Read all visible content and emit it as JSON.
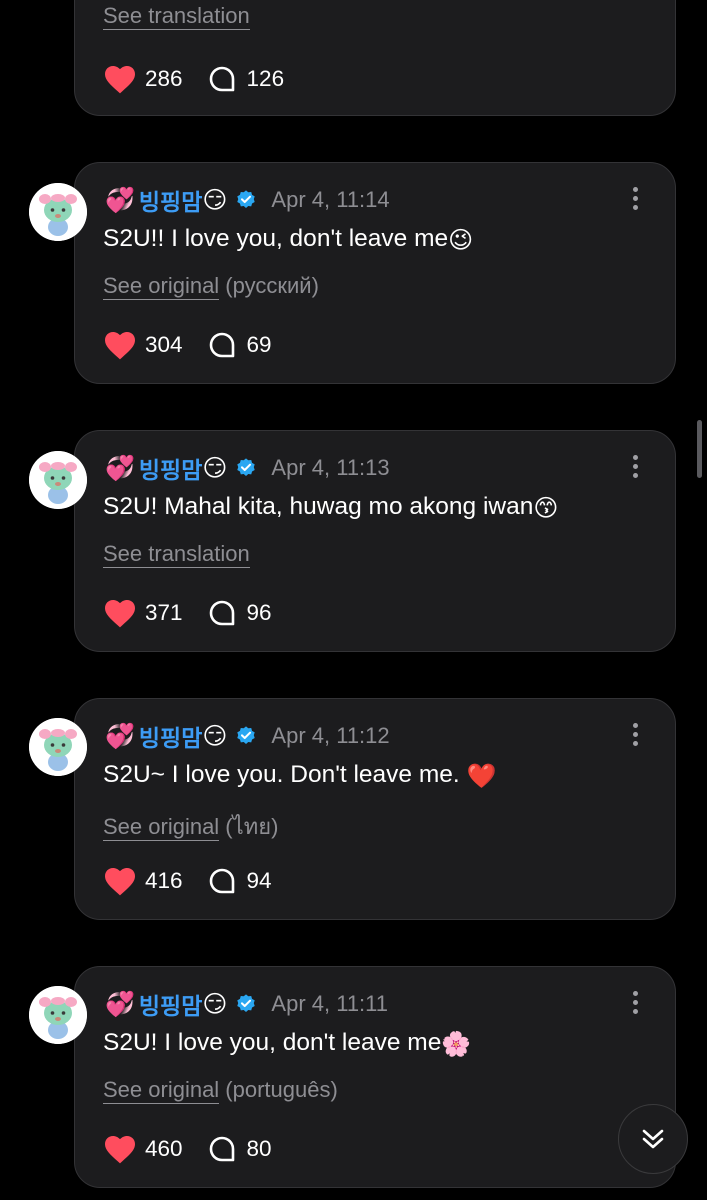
{
  "posts": [
    {
      "see_link": "See translation",
      "see_lang": "",
      "likes": "286",
      "comments": "126"
    },
    {
      "badge_emoji": "💞",
      "username": "빙핑맘",
      "name_emoji": "😏",
      "date": "Apr 4, 11:14",
      "text": "S2U!! I love you, don't leave me",
      "text_emoji": "😉",
      "see_link": "See original",
      "see_lang": " (русский)",
      "likes": "304",
      "comments": "69"
    },
    {
      "badge_emoji": "💞",
      "username": "빙핑맘",
      "name_emoji": "😏",
      "date": "Apr 4, 11:13",
      "text": "S2U! Mahal kita, huwag mo akong iwan",
      "text_emoji": "😙",
      "see_link": "See translation",
      "see_lang": "",
      "likes": "371",
      "comments": "96"
    },
    {
      "badge_emoji": "💞",
      "username": "빙핑맘",
      "name_emoji": "😏",
      "date": "Apr 4, 11:12",
      "text": "S2U~ I love you. Don't leave me. ",
      "text_emoji": "❤️",
      "see_link": "See original",
      "see_lang": " (ไทย)",
      "likes": "416",
      "comments": "94"
    },
    {
      "badge_emoji": "💞",
      "username": "빙핑맘",
      "name_emoji": "😏",
      "date": "Apr 4, 11:11",
      "text": "S2U! I love you, don't leave me",
      "text_emoji": "🌸",
      "see_link": "See original",
      "see_lang": " (português)",
      "likes": "460",
      "comments": "80"
    }
  ],
  "icons": {
    "like": "heart-icon",
    "comment": "comment-bubble-icon",
    "more": "more-vertical-icon",
    "verified": "verified-badge-icon",
    "scroll": "double-chevron-down-icon"
  },
  "colors": {
    "background": "#000000",
    "card": "#1c1c1e",
    "heart": "#ff4d5e",
    "username": "#3d9cf5",
    "verified": "#2aa7f2",
    "muted": "#8e8e93"
  }
}
